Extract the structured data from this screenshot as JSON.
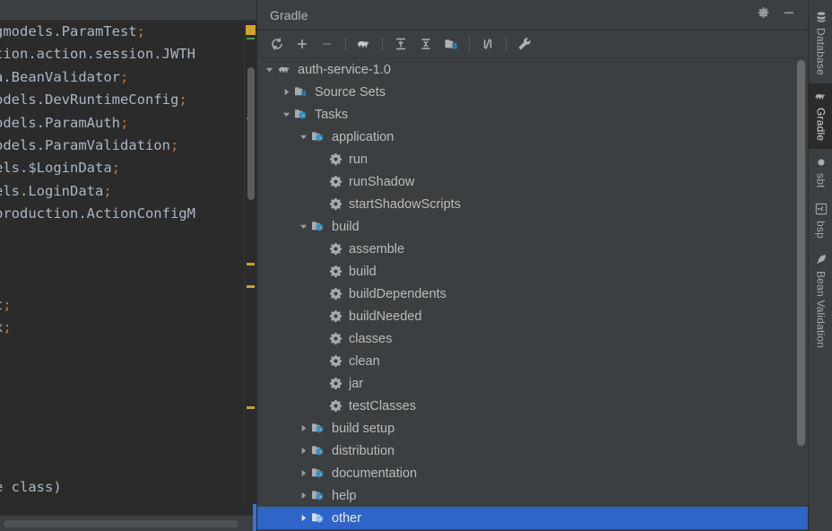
{
  "editor": {
    "name": "code-editor",
    "lines": [
      {
        "text": "gmodels.ParamTest",
        "semi": true
      },
      {
        "text": "tion.action.session.JWTH",
        "semi": false
      },
      {
        "text": "a.BeanValidator",
        "semi": true
      },
      {
        "text": "odels.DevRuntimeConfig",
        "semi": true
      },
      {
        "text": "odels.ParamAuth",
        "semi": true
      },
      {
        "text": "odels.ParamValidation",
        "semi": true
      },
      {
        "text": "els.$LoginData",
        "semi": true
      },
      {
        "text": "els.LoginData",
        "semi": true
      },
      {
        "text": "production.ActionConfigM",
        "semi": false
      },
      {
        "text": "",
        "semi": false
      },
      {
        "text": "",
        "semi": false
      },
      {
        "text": "",
        "semi": false
      },
      {
        "text": "t",
        "semi": true
      },
      {
        "text": "x",
        "semi": true
      },
      {
        "text": "",
        "semi": false
      },
      {
        "text": "",
        "semi": false
      },
      {
        "text": "",
        "semi": false
      },
      {
        "text": "",
        "semi": false
      },
      {
        "text": "",
        "semi": false
      },
      {
        "text": "",
        "semi": false
      },
      {
        "text": "e class)",
        "semi": false
      }
    ],
    "colors": {
      "background": "#2b2b2b",
      "text": "#a9b7c6",
      "punctuation": "#cc7832",
      "warning_stripe": "#c9a032",
      "info_stripe": "#499c54",
      "caret_accent": "#3573d8"
    }
  },
  "toolwindow": {
    "title": "Gradle",
    "header_actions": [
      {
        "name": "settings-gear-icon",
        "label": "Settings"
      },
      {
        "name": "minimize-icon",
        "label": "Hide"
      }
    ],
    "toolbar": [
      {
        "name": "refresh-icon",
        "label": "Reload All Gradle Projects"
      },
      {
        "name": "plus-icon",
        "label": "Link Gradle Project"
      },
      {
        "name": "minus-icon",
        "label": "Detach Gradle Project"
      },
      {
        "name": "separator-1",
        "label": ""
      },
      {
        "name": "gradle-elephant-icon",
        "label": "Execute Gradle Task"
      },
      {
        "name": "separator-2",
        "label": ""
      },
      {
        "name": "expand-all-icon",
        "label": "Expand All"
      },
      {
        "name": "collapse-all-icon",
        "label": "Collapse All"
      },
      {
        "name": "module-folder-icon",
        "label": "Show Modules"
      },
      {
        "name": "separator-3",
        "label": ""
      },
      {
        "name": "toggle-offline-icon",
        "label": "Toggle Offline Mode"
      },
      {
        "name": "separator-4",
        "label": ""
      },
      {
        "name": "wrench-icon",
        "label": "Build Tool Settings"
      }
    ],
    "tree": [
      {
        "label": "auth-service-1.0",
        "depth": 0,
        "arrow": "expanded",
        "icon": "gradle-elephant-icon",
        "selected": false
      },
      {
        "label": "Source Sets",
        "depth": 1,
        "arrow": "collapsed",
        "icon": "source-sets-folder-icon",
        "selected": false
      },
      {
        "label": "Tasks",
        "depth": 1,
        "arrow": "expanded",
        "icon": "task-folder-icon",
        "selected": false
      },
      {
        "label": "application",
        "depth": 2,
        "arrow": "expanded",
        "icon": "task-folder-icon",
        "selected": false
      },
      {
        "label": "run",
        "depth": 3,
        "arrow": "none",
        "icon": "gear-task-icon",
        "selected": false
      },
      {
        "label": "runShadow",
        "depth": 3,
        "arrow": "none",
        "icon": "gear-task-icon",
        "selected": false
      },
      {
        "label": "startShadowScripts",
        "depth": 3,
        "arrow": "none",
        "icon": "gear-task-icon",
        "selected": false
      },
      {
        "label": "build",
        "depth": 2,
        "arrow": "expanded",
        "icon": "task-folder-icon",
        "selected": false
      },
      {
        "label": "assemble",
        "depth": 3,
        "arrow": "none",
        "icon": "gear-task-icon",
        "selected": false
      },
      {
        "label": "build",
        "depth": 3,
        "arrow": "none",
        "icon": "gear-task-icon",
        "selected": false
      },
      {
        "label": "buildDependents",
        "depth": 3,
        "arrow": "none",
        "icon": "gear-task-icon",
        "selected": false
      },
      {
        "label": "buildNeeded",
        "depth": 3,
        "arrow": "none",
        "icon": "gear-task-icon",
        "selected": false
      },
      {
        "label": "classes",
        "depth": 3,
        "arrow": "none",
        "icon": "gear-task-icon",
        "selected": false
      },
      {
        "label": "clean",
        "depth": 3,
        "arrow": "none",
        "icon": "gear-task-icon",
        "selected": false
      },
      {
        "label": "jar",
        "depth": 3,
        "arrow": "none",
        "icon": "gear-task-icon",
        "selected": false
      },
      {
        "label": "testClasses",
        "depth": 3,
        "arrow": "none",
        "icon": "gear-task-icon",
        "selected": false
      },
      {
        "label": "build setup",
        "depth": 2,
        "arrow": "collapsed",
        "icon": "task-folder-icon",
        "selected": false
      },
      {
        "label": "distribution",
        "depth": 2,
        "arrow": "collapsed",
        "icon": "task-folder-icon",
        "selected": false
      },
      {
        "label": "documentation",
        "depth": 2,
        "arrow": "collapsed",
        "icon": "task-folder-icon",
        "selected": false
      },
      {
        "label": "help",
        "depth": 2,
        "arrow": "collapsed",
        "icon": "task-folder-icon",
        "selected": false
      },
      {
        "label": "other",
        "depth": 2,
        "arrow": "collapsed",
        "icon": "task-folder-icon",
        "selected": true
      }
    ],
    "colors": {
      "panel_background": "#3c3f41",
      "selection": "#2f65c8",
      "text": "#bbbbbb",
      "icon_accent": "#3592c4"
    }
  },
  "right_stripe": {
    "tabs": [
      {
        "label": "Database",
        "icon": "database-icon",
        "active": false
      },
      {
        "label": "Gradle",
        "icon": "gradle-elephant-icon",
        "active": true
      },
      {
        "label": "sbt",
        "icon": "sbt-dot-icon",
        "active": false
      },
      {
        "label": "bsp",
        "icon": "bsp-icon",
        "active": false
      },
      {
        "label": "Bean Validation",
        "icon": "bean-validation-icon",
        "active": false
      }
    ]
  }
}
